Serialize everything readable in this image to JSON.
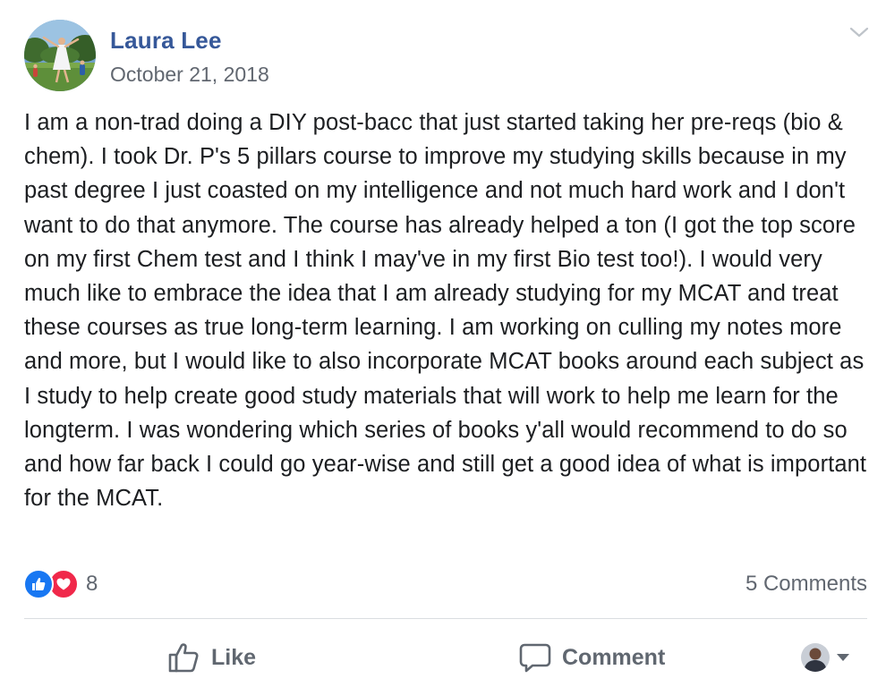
{
  "post": {
    "author": "Laura Lee",
    "date": "October 21, 2018",
    "text": "I am a non-trad doing a DIY post-bacc that just started taking her pre-reqs (bio & chem). I took Dr. P's 5 pillars course to improve my studying skills because in my past degree I just coasted on my intelligence and not much hard work and I don't want to do that anymore. The course has already helped a ton (I got the top score on my first Chem test and I think I may've in my first Bio test too!). I would very much like to embrace the idea that I am already studying for my MCAT and treat these courses as true long-term learning. I am working on culling my notes more and more, but I would like to also incorporate MCAT books around each subject as I study to help create good study materials that will work to help me learn for the longterm. I was wondering which series of books y'all would recommend to do so and how far back I could go year-wise and still get a good idea of what is important for the MCAT."
  },
  "reactions": {
    "count": "8",
    "types": [
      "like-icon",
      "love-icon"
    ]
  },
  "comments_count": "5 Comments",
  "actions": {
    "like_label": "Like",
    "comment_label": "Comment"
  },
  "icons": {
    "options": "chevron-down-icon",
    "share_caret": "caret-down-icon"
  },
  "colors": {
    "author": "#365899",
    "meta": "#616770",
    "like_blue": "#1877f2",
    "love_red": "#f0284a",
    "divider": "#dadde1"
  }
}
